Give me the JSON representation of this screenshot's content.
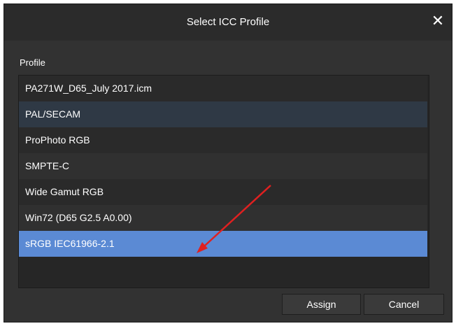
{
  "dialog": {
    "title": "Select ICC Profile",
    "close_symbol": "✕"
  },
  "profile_section": {
    "label": "Profile",
    "items": [
      {
        "label": "PA271W_D65_July 2017.icm",
        "state": "normal"
      },
      {
        "label": "PAL/SECAM",
        "state": "hover"
      },
      {
        "label": "ProPhoto RGB",
        "state": "normal"
      },
      {
        "label": "SMPTE-C",
        "state": "normal"
      },
      {
        "label": "Wide Gamut RGB",
        "state": "normal"
      },
      {
        "label": "Win72 (D65 G2.5 A0.00)",
        "state": "normal"
      },
      {
        "label": "sRGB IEC61966-2.1",
        "state": "selected"
      }
    ]
  },
  "buttons": {
    "assign": "Assign",
    "cancel": "Cancel"
  },
  "colors": {
    "selected": "#5b8ad4",
    "hover": "#2f3945",
    "annotation_arrow": "#e02020"
  },
  "icons": [
    "close-icon",
    "scroll-up-icon",
    "scroll-down-icon",
    "annotation-arrow-icon"
  ]
}
